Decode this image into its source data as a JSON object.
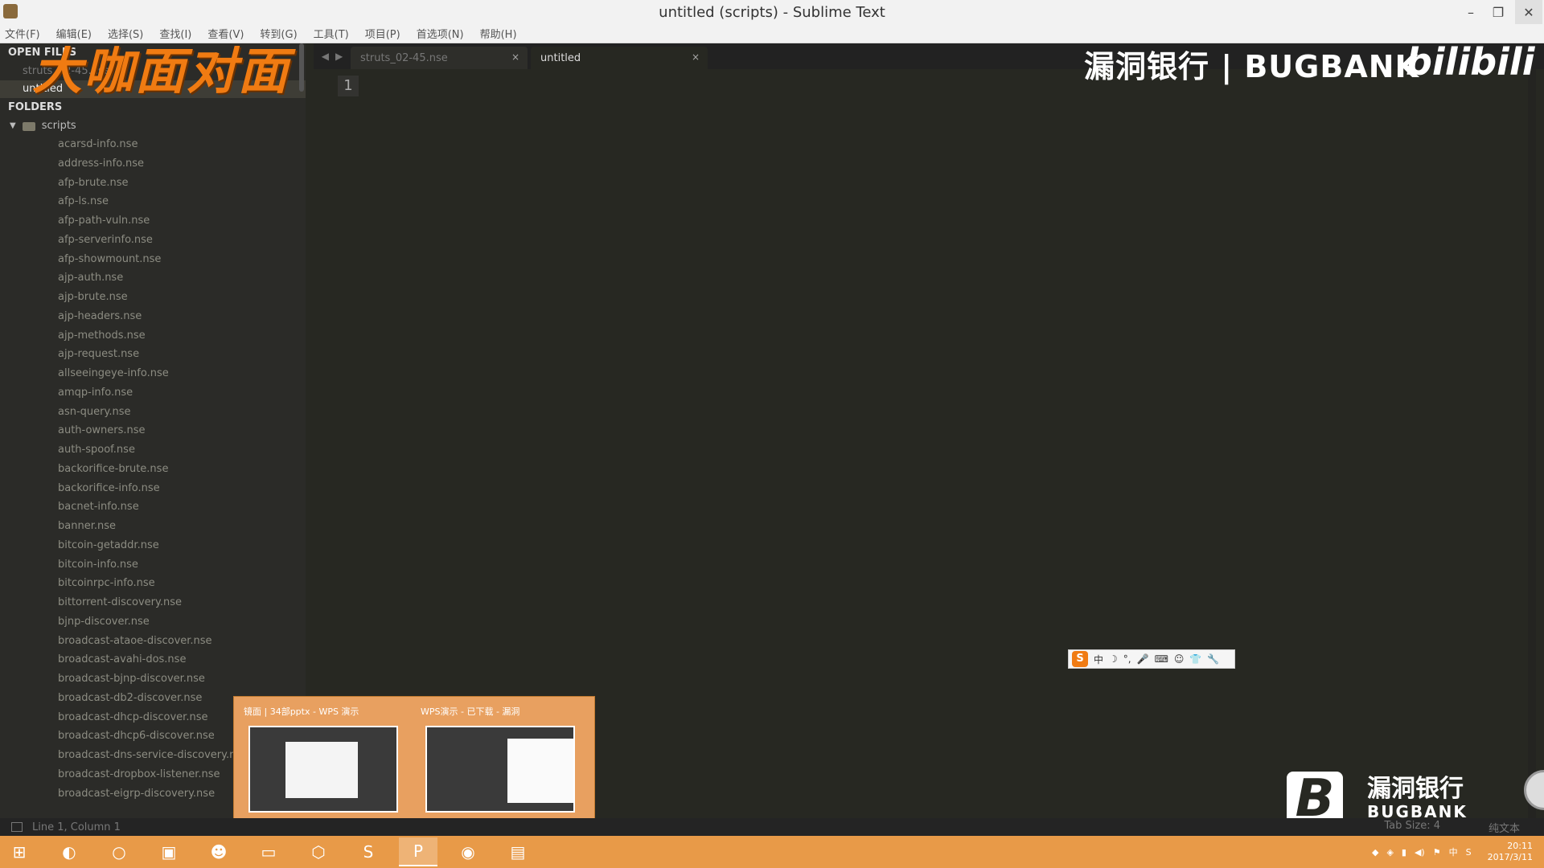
{
  "window": {
    "title": "untitled (scripts) - Sublime Text"
  },
  "menu": [
    "文件(F)",
    "编辑(E)",
    "选择(S)",
    "查找(I)",
    "查看(V)",
    "转到(G)",
    "工具(T)",
    "项目(P)",
    "首选项(N)",
    "帮助(H)"
  ],
  "sidebar": {
    "open_files_header": "OPEN FILES",
    "open_files": [
      "struts_02-45.nse",
      "untitled"
    ],
    "folders_header": "FOLDERS",
    "folder_name": "scripts",
    "files": [
      "acarsd-info.nse",
      "address-info.nse",
      "afp-brute.nse",
      "afp-ls.nse",
      "afp-path-vuln.nse",
      "afp-serverinfo.nse",
      "afp-showmount.nse",
      "ajp-auth.nse",
      "ajp-brute.nse",
      "ajp-headers.nse",
      "ajp-methods.nse",
      "ajp-request.nse",
      "allseeingeye-info.nse",
      "amqp-info.nse",
      "asn-query.nse",
      "auth-owners.nse",
      "auth-spoof.nse",
      "backorifice-brute.nse",
      "backorifice-info.nse",
      "bacnet-info.nse",
      "banner.nse",
      "bitcoin-getaddr.nse",
      "bitcoin-info.nse",
      "bitcoinrpc-info.nse",
      "bittorrent-discovery.nse",
      "bjnp-discover.nse",
      "broadcast-ataoe-discover.nse",
      "broadcast-avahi-dos.nse",
      "broadcast-bjnp-discover.nse",
      "broadcast-db2-discover.nse",
      "broadcast-dhcp-discover.nse",
      "broadcast-dhcp6-discover.nse",
      "broadcast-dns-service-discovery.nse",
      "broadcast-dropbox-listener.nse",
      "broadcast-eigrp-discovery.nse"
    ]
  },
  "tabs": [
    {
      "label": "struts_02-45.nse",
      "close": "×"
    },
    {
      "label": "untitled",
      "close": "×"
    }
  ],
  "editor": {
    "line_number": "1"
  },
  "watermark": {
    "left": "大咖面对面",
    "brand": "漏洞银行 | BUGBANK",
    "bili": "bilibili",
    "bottom_cn": "漏洞银行",
    "bottom_en": "BUGBANK",
    "bottom_logo": "B"
  },
  "ime": {
    "logo": "S",
    "mode": "中"
  },
  "taskbar_preview": [
    {
      "title": "镜面 | 34部pptx - WPS 演示"
    },
    {
      "title": "WPS演示 - 已下载 - 漏洞"
    }
  ],
  "status": {
    "position": "Line 1, Column 1",
    "tab_size": "Tab Size: 4",
    "syntax": "纯文本"
  },
  "clock": {
    "time": "20:11",
    "date": "2017/3/11"
  }
}
